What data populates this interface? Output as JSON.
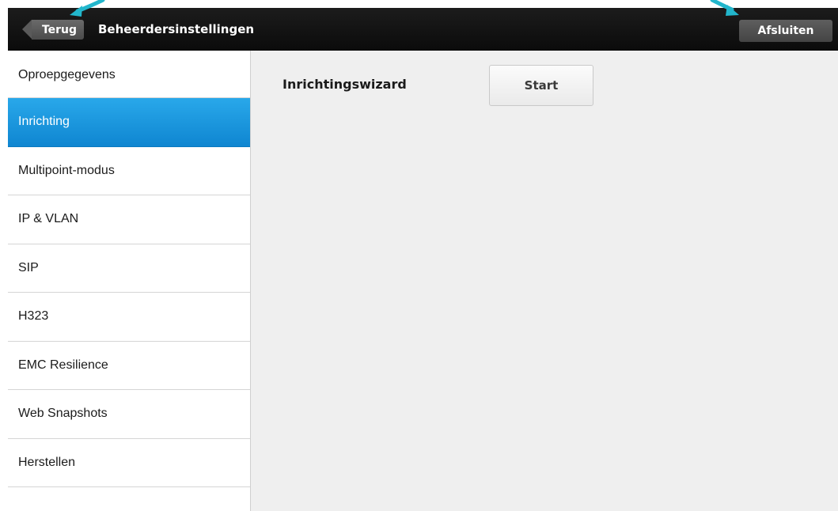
{
  "header": {
    "back_label": "Terug",
    "title": "Beheerdersinstellingen",
    "exit_label": "Afsluiten"
  },
  "sidebar": {
    "items": [
      {
        "label": "Oproepgegevens"
      },
      {
        "label": "Inrichting"
      },
      {
        "label": "Multipoint-modus"
      },
      {
        "label": "IP & VLAN"
      },
      {
        "label": "SIP"
      },
      {
        "label": "H323"
      },
      {
        "label": "EMC Resilience"
      },
      {
        "label": "Web Snapshots"
      },
      {
        "label": "Herstellen"
      }
    ],
    "active": "Inrichting"
  },
  "main": {
    "setting_label": "Inrichtingswizard",
    "start_label": "Start"
  },
  "colors": {
    "accent": "#1a96dd",
    "annotation_arrow": "#22b6cc",
    "topbar": "#111111"
  }
}
